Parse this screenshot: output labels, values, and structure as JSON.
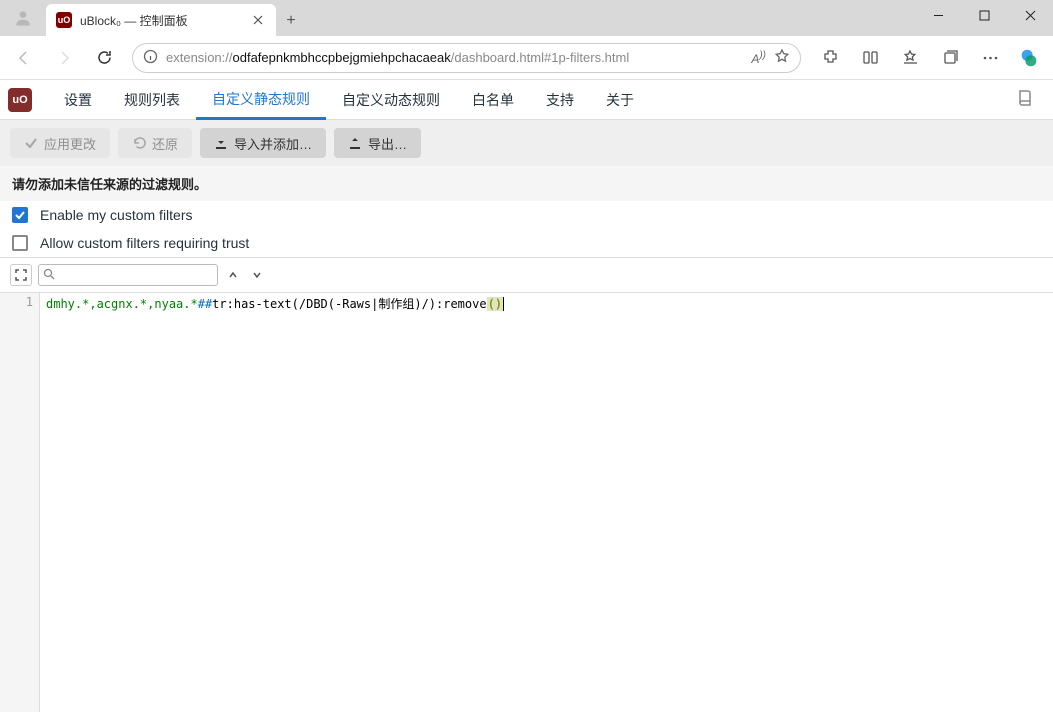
{
  "window": {
    "tab_title": "uBlock₀ — 控制面板"
  },
  "addressbar": {
    "url_prefix": "extension://",
    "url_bold": "odfafepnkmbhccpbejgmiehpchacaeak",
    "url_suffix": "/dashboard.html#1p-filters.html"
  },
  "dashnav": {
    "logo": "uO",
    "tabs": {
      "settings": "设置",
      "filters": "规则列表",
      "myfilters": "自定义静态规则",
      "myrules": "自定义动态规则",
      "whitelist": "白名单",
      "support": "支持",
      "about": "关于"
    }
  },
  "toolbar": {
    "apply": "应用更改",
    "revert": "还原",
    "import": "导入并添加…",
    "export": "导出…"
  },
  "warning": "请勿添加未信任来源的过滤规则。",
  "checks": {
    "enable": "Enable my custom filters",
    "trust": "Allow custom filters requiring trust"
  },
  "editor": {
    "line_no": "1",
    "line1_domains": "dmhy.*,acgnx.*,nyaa.*",
    "line1_sep": "##",
    "line1_sel": "tr:has-text(/DBD(-Raws|制作组)/):remove"
  }
}
